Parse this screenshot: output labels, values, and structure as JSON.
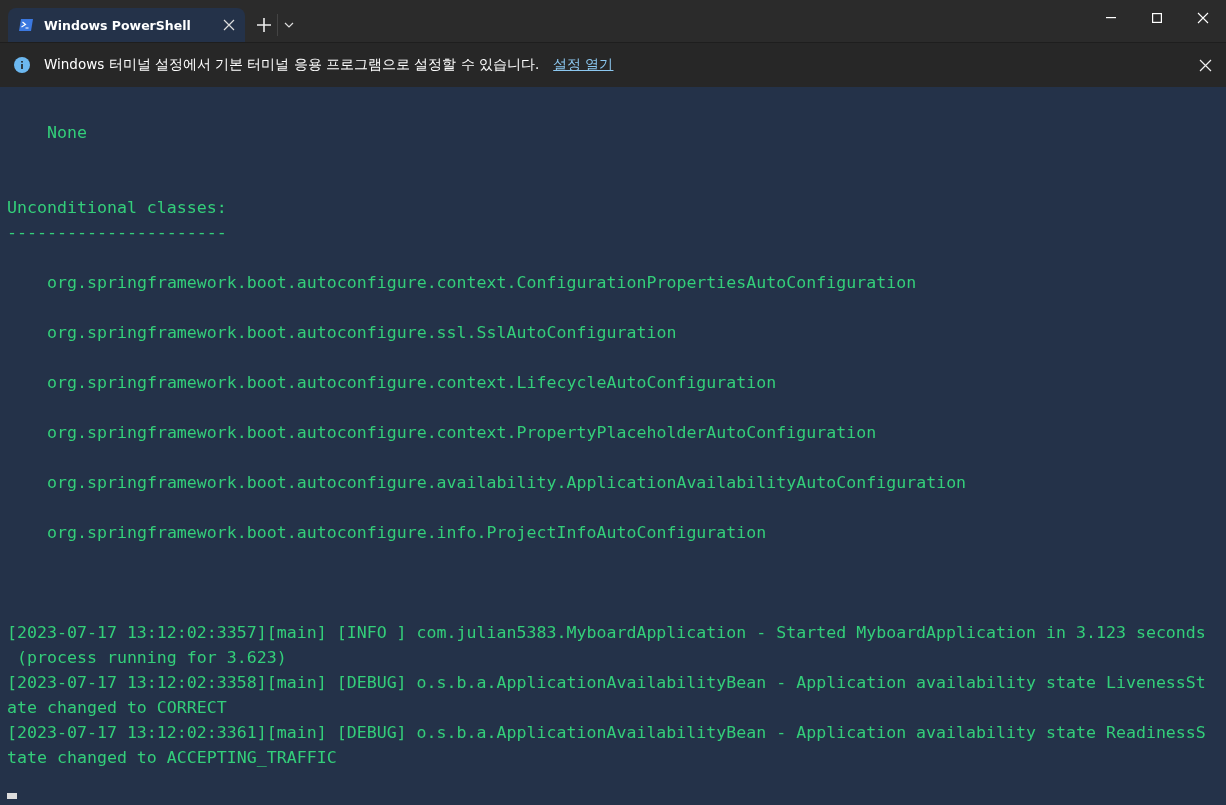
{
  "tabs": [
    {
      "title": "Windows PowerShell",
      "selected": true
    }
  ],
  "infobar": {
    "message": "Windows 터미널 설정에서 기본 터미널 응용 프로그램으로 설정할 수 있습니다.",
    "link": "설정 열기"
  },
  "terminal": {
    "lines": [
      {
        "kind": "item",
        "text": "None"
      },
      {
        "kind": "heading",
        "text": "Unconditional classes:"
      },
      {
        "kind": "rule",
        "text": "----------------------"
      },
      {
        "kind": "item",
        "text": "org.springframework.boot.autoconfigure.context.ConfigurationPropertiesAutoConfiguration"
      },
      {
        "kind": "item",
        "text": "org.springframework.boot.autoconfigure.ssl.SslAutoConfiguration"
      },
      {
        "kind": "item",
        "text": "org.springframework.boot.autoconfigure.context.LifecycleAutoConfiguration"
      },
      {
        "kind": "item",
        "text": "org.springframework.boot.autoconfigure.context.PropertyPlaceholderAutoConfiguration"
      },
      {
        "kind": "item",
        "text": "org.springframework.boot.autoconfigure.availability.ApplicationAvailabilityAutoConfiguration"
      },
      {
        "kind": "item",
        "text": "org.springframework.boot.autoconfigure.info.ProjectInfoAutoConfiguration"
      },
      {
        "kind": "log",
        "text": "[2023-07-17 13:12:02:3357][main] [INFO ] com.julian5383.MyboardApplication - Started MyboardApplication in 3.123 seconds"
      },
      {
        "kind": "log",
        "text": " (process running for 3.623)"
      },
      {
        "kind": "log",
        "text": "[2023-07-17 13:12:02:3358][main] [DEBUG] o.s.b.a.ApplicationAvailabilityBean - Application availability state LivenessSt"
      },
      {
        "kind": "log",
        "text": "ate changed to CORRECT"
      },
      {
        "kind": "log",
        "text": "[2023-07-17 13:12:02:3361][main] [DEBUG] o.s.b.a.ApplicationAvailabilityBean - Application availability state ReadinessS"
      },
      {
        "kind": "log",
        "text": "tate changed to ACCEPTING_TRAFFIC"
      }
    ]
  }
}
